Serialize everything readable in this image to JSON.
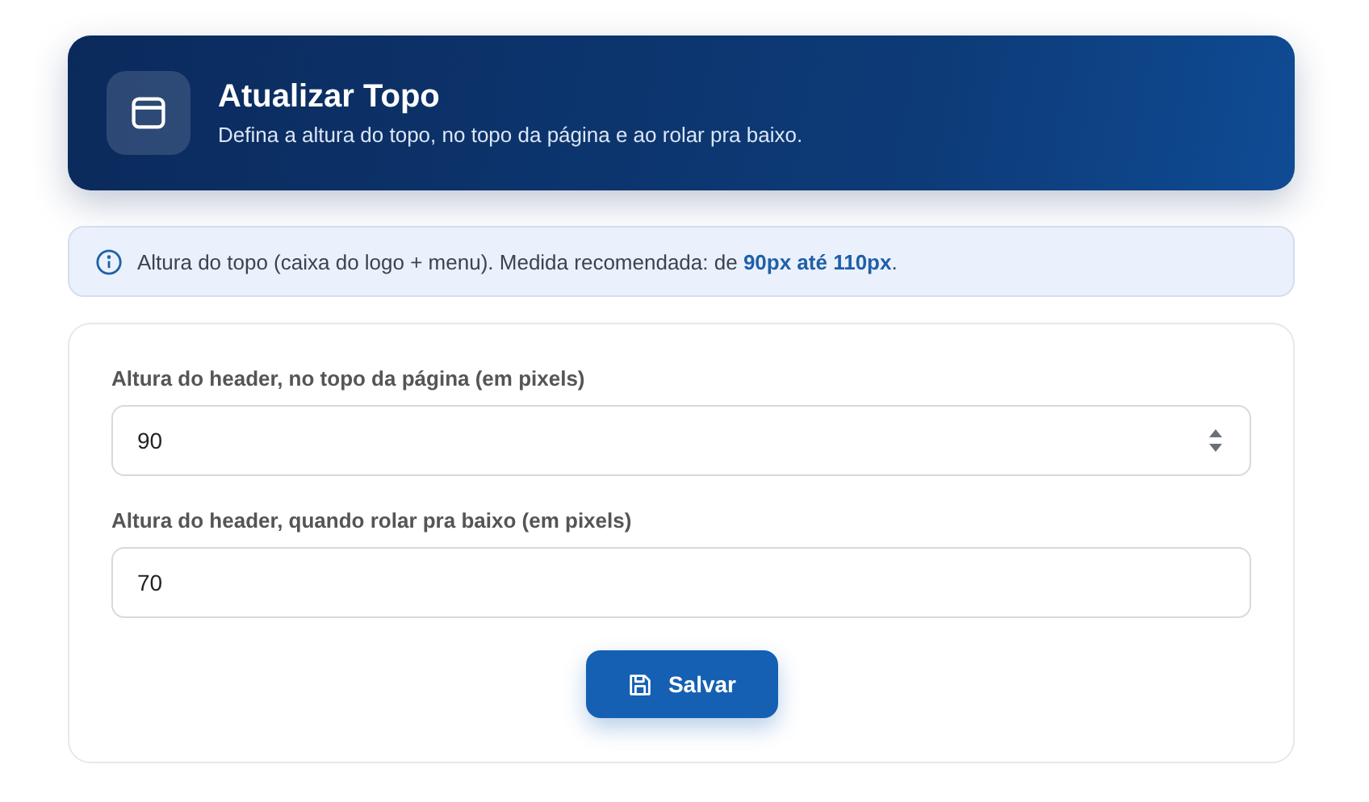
{
  "header": {
    "title": "Atualizar Topo",
    "subtitle": "Defina a altura do topo, no topo da página e ao rolar pra baixo."
  },
  "notice": {
    "text": "Altura do topo (caixa do logo + menu). Medida recomendada: de **90px até 110px**."
  },
  "fields": [
    {
      "label": "Altura do header, no topo da página (em pixels)",
      "value": "90",
      "hovered": true
    },
    {
      "label": "Altura do header, quando rolar pra baixo (em pixels)",
      "value": "70",
      "hovered": false
    }
  ],
  "save_button": {
    "label": "Salvar"
  }
}
